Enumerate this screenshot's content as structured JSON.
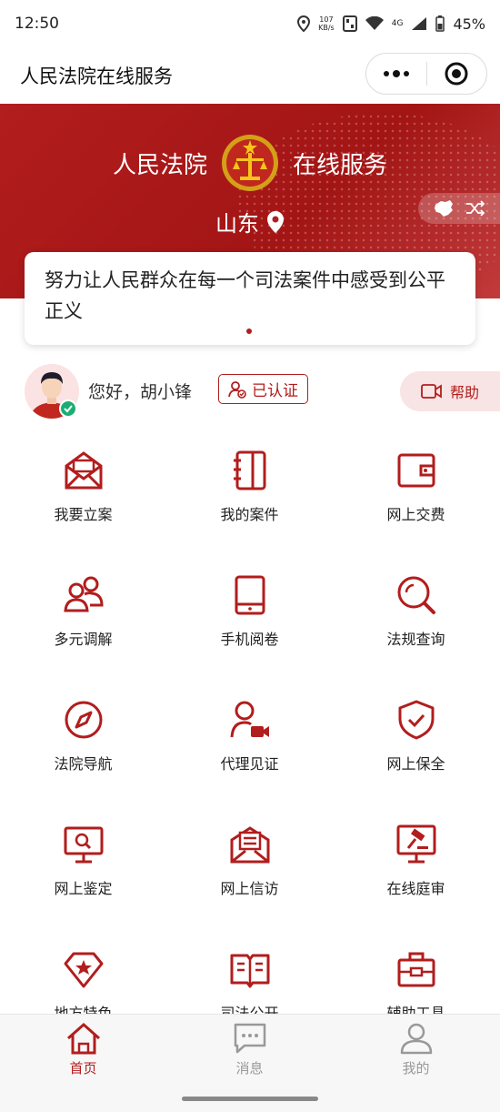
{
  "status_bar": {
    "time": "12:50",
    "net_speed_value": "107",
    "net_speed_unit": "KB/s",
    "signal_label": "4G",
    "battery": "45%"
  },
  "title_bar": {
    "title": "人民法院在线服务"
  },
  "banner": {
    "left_text": "人民法院",
    "right_text": "在线服务",
    "region": "山东"
  },
  "slogan": "努力让人民群众在每一个司法案件中感受到公平正义",
  "user": {
    "greeting": "您好，胡小锋",
    "verified_label": "已认证",
    "help_label": "帮助"
  },
  "services": [
    {
      "label": "我要立案",
      "icon": "envelope-icon"
    },
    {
      "label": "我的案件",
      "icon": "notebook-icon"
    },
    {
      "label": "网上交费",
      "icon": "wallet-icon"
    },
    {
      "label": "多元调解",
      "icon": "people-icon"
    },
    {
      "label": "手机阅卷",
      "icon": "tablet-icon"
    },
    {
      "label": "法规查询",
      "icon": "search-icon"
    },
    {
      "label": "法院导航",
      "icon": "compass-icon"
    },
    {
      "label": "代理见证",
      "icon": "person-camera-icon"
    },
    {
      "label": "网上保全",
      "icon": "shield-check-icon"
    },
    {
      "label": "网上鉴定",
      "icon": "monitor-search-icon"
    },
    {
      "label": "网上信访",
      "icon": "mail-letter-icon"
    },
    {
      "label": "在线庭审",
      "icon": "gavel-monitor-icon"
    },
    {
      "label": "地方特色",
      "icon": "star-badge-icon"
    },
    {
      "label": "司法公开",
      "icon": "open-book-icon"
    },
    {
      "label": "辅助工具",
      "icon": "toolbox-icon"
    }
  ],
  "bottom_nav": [
    {
      "label": "首页",
      "icon": "home-icon",
      "active": true
    },
    {
      "label": "消息",
      "icon": "message-icon",
      "active": false
    },
    {
      "label": "我的",
      "icon": "user-icon",
      "active": false
    }
  ],
  "colors": {
    "accent": "#b21d1d",
    "inactive": "#999999",
    "badge": "#1aae73"
  }
}
